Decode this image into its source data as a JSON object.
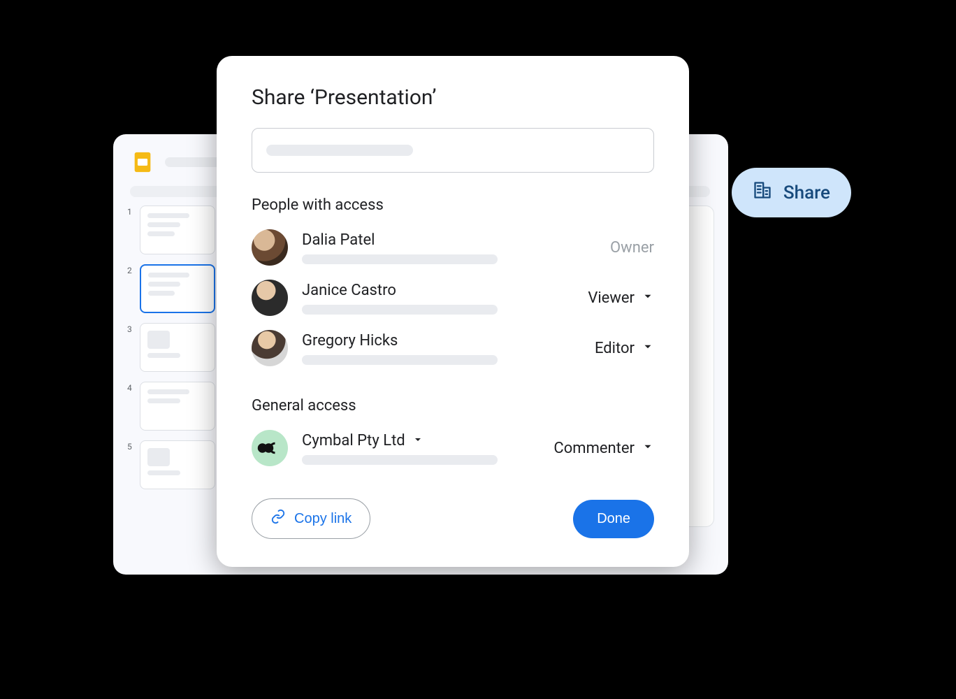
{
  "background": {
    "app": "Google Slides",
    "thumbnails": [
      {
        "number": "1"
      },
      {
        "number": "2"
      },
      {
        "number": "3"
      },
      {
        "number": "4"
      },
      {
        "number": "5"
      }
    ],
    "selected_thumbnail_index": 1
  },
  "share_callout": {
    "label": "Share",
    "icon": "building-icon"
  },
  "modal": {
    "title": "Share ‘Presentation’",
    "add_people_placeholder": "",
    "people_section_label": "People with access",
    "people": [
      {
        "name": "Dalia Patel",
        "role": "Owner",
        "role_editable": false
      },
      {
        "name": "Janice Castro",
        "role": "Viewer",
        "role_editable": true
      },
      {
        "name": "Gregory Hicks",
        "role": "Editor",
        "role_editable": true
      }
    ],
    "general_section_label": "General access",
    "general": {
      "scope": "Cymbal Pty Ltd",
      "role": "Commenter",
      "org_icon": "cymbal-logo"
    },
    "copy_link_label": "Copy link",
    "done_label": "Done"
  }
}
